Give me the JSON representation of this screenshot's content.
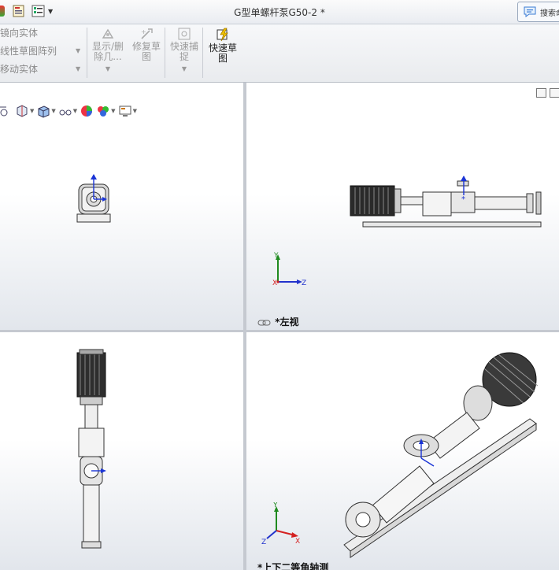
{
  "window": {
    "title": "G型单螺杆泵G50-2 *",
    "search_label": "搜索命令"
  },
  "ribbon": {
    "rows": [
      "镜向实体",
      "线性草图阵列",
      "移动实体"
    ],
    "buttons": {
      "show_delete": "显示/删除几...",
      "repair_sketch": "修复草图",
      "quick_snap": "快速捕捉",
      "quick_sketch": "快速草图"
    }
  },
  "viewports": {
    "top_right_label": "*左视",
    "bottom_right_label": "*上下二等角轴测"
  },
  "triad": {
    "x": "X",
    "y": "Y",
    "z": "Z"
  },
  "colors": {
    "ribbon_bg": "#eceef1",
    "viewport_top": "#ffffff",
    "viewport_bottom": "#e2e6ec",
    "axis_x": "#d42020",
    "axis_y": "#1f8a1f",
    "axis_z": "#2233cc"
  }
}
